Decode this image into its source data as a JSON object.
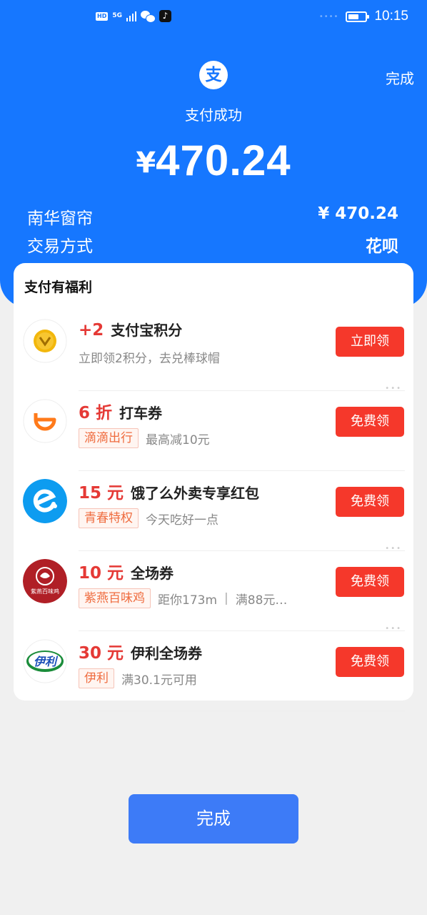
{
  "status_bar": {
    "network": "5G",
    "hd": "HD",
    "tiktok_glyph": "♪",
    "time": "10:15"
  },
  "header": {
    "done_label": "完成",
    "logo_glyph": "支",
    "status_text": "支付成功",
    "currency": "¥",
    "amount": "470.24"
  },
  "details": [
    {
      "label": "南华窗帘",
      "value": "¥ 470.24"
    },
    {
      "label": "交易方式",
      "value": "花呗"
    }
  ],
  "benefits": {
    "title": "支付有福利",
    "items": [
      {
        "highlight": "+2",
        "title": "支付宝积分",
        "tag": "",
        "desc": "立即领2积分，去兑棒球帽",
        "button": "立即领",
        "icon": "points-coin-icon"
      },
      {
        "highlight": "6 折",
        "title": "打车券",
        "tag": "滴滴出行",
        "desc": "最高减10元",
        "button": "免费领",
        "icon": "didi-logo-icon"
      },
      {
        "highlight": "15 元",
        "title": "饿了么外卖专享红包",
        "tag": "青春特权",
        "desc": "今天吃好一点",
        "button": "免费领",
        "icon": "eleme-logo-icon"
      },
      {
        "highlight": "10 元",
        "title": "全场券",
        "tag": "紫燕百味鸡",
        "desc": "距你173m",
        "desc2": "满88元…",
        "button": "免费领",
        "icon": "ziyan-logo-icon",
        "logo_text": "紫燕百味鸡"
      },
      {
        "highlight": "30 元",
        "title": "伊利全场券",
        "tag": "伊利",
        "desc": "满30.1元可用",
        "button": "免费领",
        "icon": "yili-logo-icon",
        "logo_text": "伊利"
      }
    ]
  },
  "footer": {
    "done_label": "完成"
  },
  "colors": {
    "brand_blue": "#1677ff",
    "button_red": "#f5382b",
    "highlight_red": "#e53935",
    "finish_blue": "#3d7bf7"
  }
}
